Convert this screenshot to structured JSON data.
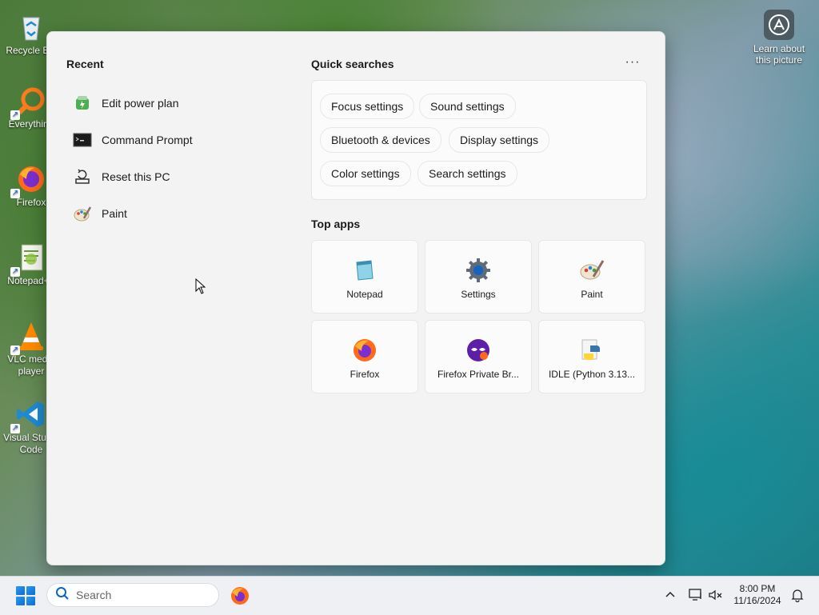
{
  "desktop": {
    "icons": [
      {
        "label": "Recycle Bin",
        "icon": "recycle-bin-icon"
      },
      {
        "label": "Everything",
        "icon": "everything-search-icon"
      },
      {
        "label": "Firefox",
        "icon": "firefox-icon"
      },
      {
        "label": "Notepad++",
        "icon": "notepad-plus-plus-icon"
      },
      {
        "label": "VLC media player",
        "icon": "vlc-icon"
      },
      {
        "label": "Visual Studio Code",
        "icon": "vscode-icon"
      }
    ],
    "learn_label": "Learn about this picture"
  },
  "start_menu": {
    "recent_title": "Recent",
    "recent": [
      {
        "label": "Edit power plan",
        "icon": "power-plan-icon"
      },
      {
        "label": "Command Prompt",
        "icon": "command-prompt-icon"
      },
      {
        "label": "Reset this PC",
        "icon": "reset-pc-icon"
      },
      {
        "label": "Paint",
        "icon": "paint-icon"
      }
    ],
    "quick_title": "Quick searches",
    "more_label": "···",
    "quick": [
      "Focus settings",
      "Sound settings",
      "Bluetooth & devices",
      "Display settings",
      "Color settings",
      "Search settings"
    ],
    "top_apps_title": "Top apps",
    "top_apps": [
      {
        "label": "Notepad",
        "icon": "notepad-icon"
      },
      {
        "label": "Settings",
        "icon": "settings-gear-icon"
      },
      {
        "label": "Paint",
        "icon": "paint-icon"
      },
      {
        "label": "Firefox",
        "icon": "firefox-icon"
      },
      {
        "label": "Firefox Private Br...",
        "icon": "firefox-private-icon"
      },
      {
        "label": "IDLE (Python 3.13...",
        "icon": "python-idle-icon"
      }
    ]
  },
  "taskbar": {
    "search_placeholder": "Search",
    "time": "8:00 PM",
    "date": "11/16/2024"
  }
}
